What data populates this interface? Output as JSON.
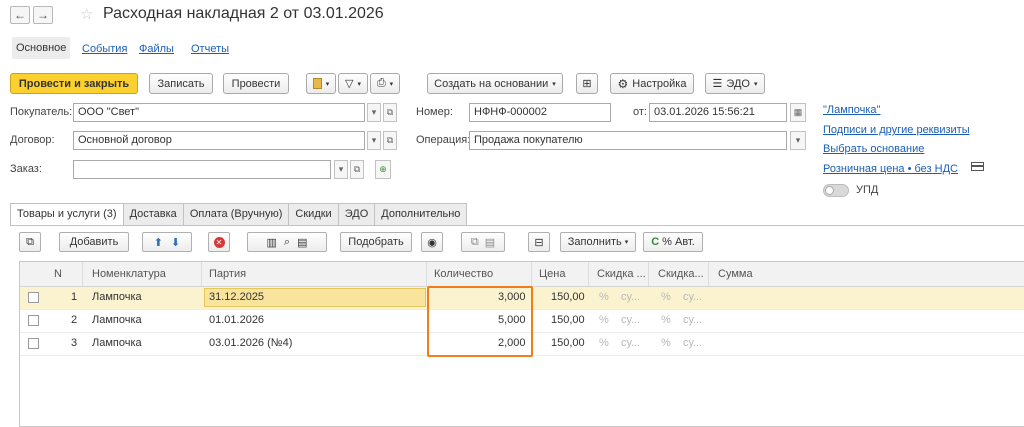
{
  "title": "Расходная накладная 2 от 03.01.2026",
  "nav": {
    "back": "←",
    "forward": "→",
    "star": "☆"
  },
  "sections": {
    "main": "Основное",
    "events": "События",
    "files": "Файлы",
    "reports": "Отчеты"
  },
  "toolbar": {
    "post_close": "Провести и закрыть",
    "save": "Записать",
    "post": "Провести",
    "create_based": "Создать на основании",
    "settings": "Настройка",
    "edo": "ЭДО"
  },
  "form": {
    "buyer_label": "Покупатель:",
    "buyer_value": "ООО \"Свет\"",
    "contract_label": "Договор:",
    "contract_value": "Основной договор",
    "order_label": "Заказ:",
    "order_value": "",
    "number_label": "Номер:",
    "number_value": "НФНФ-000002",
    "from_label": "от:",
    "date_value": "03.01.2026 15:56:21",
    "operation_label": "Операция:",
    "operation_value": "Продажа покупателю"
  },
  "right_links": {
    "org": "\"Лампочка\"",
    "signatures": "Подписи и другие реквизиты",
    "choose_base": "Выбрать основание",
    "retail_price": "Розничная цена • без НДС",
    "upd": "УПД"
  },
  "tabs": [
    "Товары и услуги (3)",
    "Доставка",
    "Оплата (Вручную)",
    "Скидки",
    "ЭДО",
    "Дополнительно"
  ],
  "table_toolbar": {
    "add": "Добавить",
    "pick": "Подобрать",
    "fill": "Заполнить",
    "percent_auto": "% Авт."
  },
  "table": {
    "headers": {
      "n": "N",
      "nomenclature": "Номенклатура",
      "batch": "Партия",
      "quantity": "Количество",
      "price": "Цена",
      "discount1": "Скидка ...",
      "discount2": "Скидка...",
      "sum": "Сумма"
    },
    "rows": [
      {
        "n": "1",
        "nomenclature": "Лампочка",
        "batch": "31.12.2025",
        "quantity": "3,000",
        "price": "150,00",
        "pct": "%",
        "cu": "су...",
        "pct2": "%",
        "cu2": "су..."
      },
      {
        "n": "2",
        "nomenclature": "Лампочка",
        "batch": "01.01.2026",
        "quantity": "5,000",
        "price": "150,00",
        "pct": "%",
        "cu": "су...",
        "pct2": "%",
        "cu2": "су..."
      },
      {
        "n": "3",
        "nomenclature": "Лампочка",
        "batch": "03.01.2026 (№4)",
        "quantity": "2,000",
        "price": "150,00",
        "pct": "%",
        "cu": "су...",
        "pct2": "%",
        "cu2": "су..."
      }
    ]
  },
  "colors": {
    "primary": "#fcd12f",
    "selected_row": "#fbf3d0",
    "highlight_box": "#f07f1a",
    "link": "#1a5fb4"
  }
}
